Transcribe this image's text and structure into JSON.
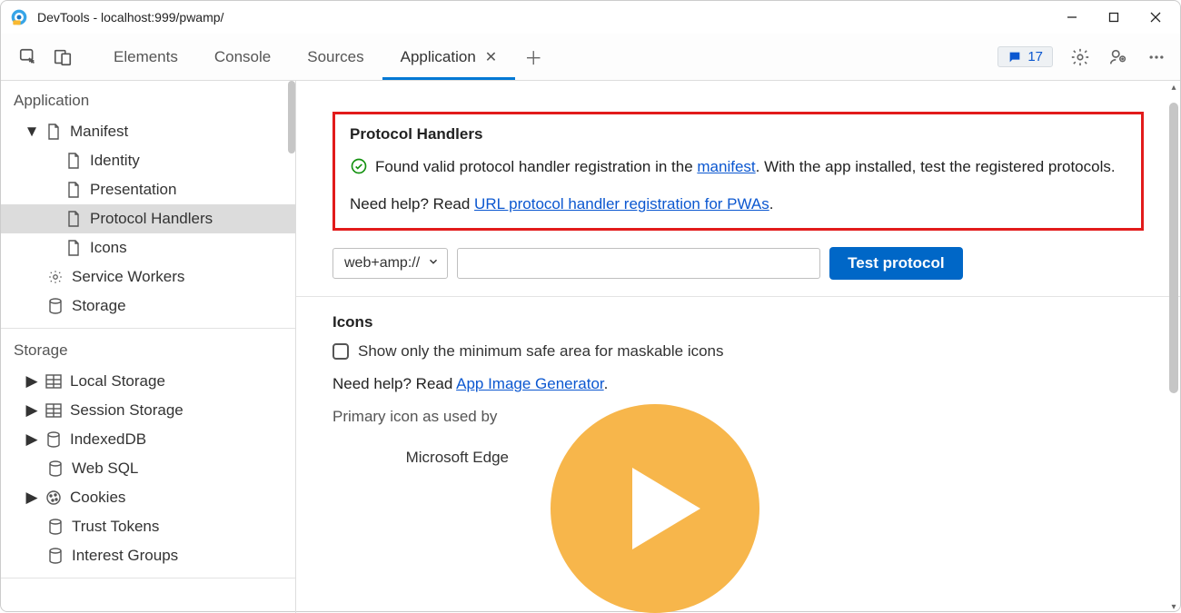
{
  "window": {
    "title": "DevTools - localhost:999/pwamp/"
  },
  "tabs": {
    "items": [
      "Elements",
      "Console",
      "Sources",
      "Application"
    ],
    "active": "Application"
  },
  "toolbar": {
    "issues_count": "17"
  },
  "sidebar": {
    "section_app": "Application",
    "manifest": "Manifest",
    "manifest_children": [
      "Identity",
      "Presentation",
      "Protocol Handlers",
      "Icons"
    ],
    "service_workers": "Service Workers",
    "storage": "Storage",
    "section_storage": "Storage",
    "local_storage": "Local Storage",
    "session_storage": "Session Storage",
    "indexeddb": "IndexedDB",
    "web_sql": "Web SQL",
    "cookies": "Cookies",
    "trust_tokens": "Trust Tokens",
    "interest_groups": "Interest Groups"
  },
  "protocol_handlers": {
    "title": "Protocol Handlers",
    "status_pre": "Found valid protocol handler registration in the ",
    "status_link": "manifest",
    "status_post": ". With the app installed, test the registered protocols.",
    "help_pre": "Need help? Read ",
    "help_link": "URL protocol handler registration for PWAs",
    "help_post": ".",
    "select_value": "web+amp://",
    "input_value": "",
    "button": "Test protocol"
  },
  "icons_section": {
    "title": "Icons",
    "checkbox_label": "Show only the minimum safe area for maskable icons",
    "help_pre": "Need help? Read ",
    "help_link": "App Image Generator",
    "help_post": ".",
    "primary_label_line1": "Primary icon as used by",
    "primary_label_line2": "Microsoft Edge"
  }
}
